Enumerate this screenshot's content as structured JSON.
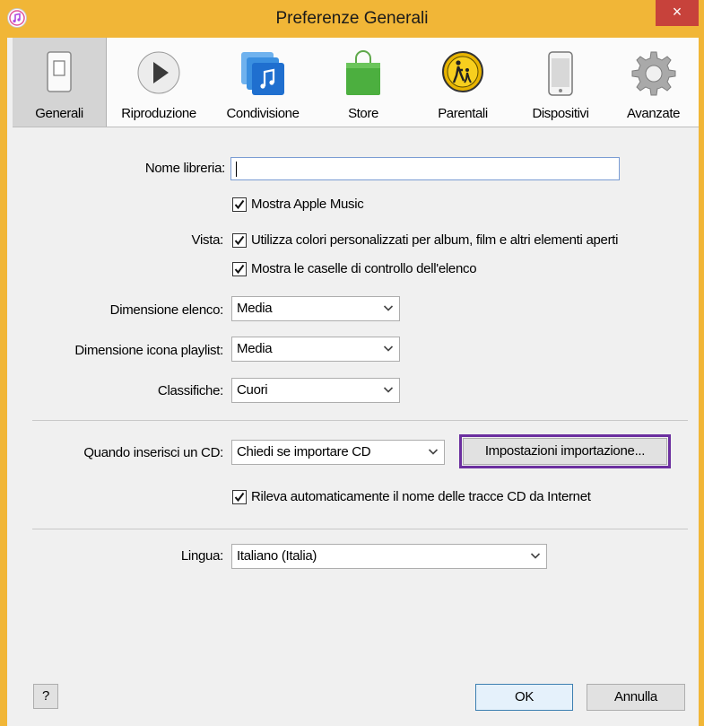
{
  "window": {
    "title": "Preferenze Generali",
    "close_label": "×",
    "accent_color": "#f1b637"
  },
  "toolbar": {
    "tabs": [
      {
        "label": "Generali",
        "icon": "general-switch-icon",
        "active": true
      },
      {
        "label": "Riproduzione",
        "icon": "play-icon"
      },
      {
        "label": "Condivisione",
        "icon": "sharing-music-icon"
      },
      {
        "label": "Store",
        "icon": "shopping-bag-icon"
      },
      {
        "label": "Parentali",
        "icon": "parental-icon"
      },
      {
        "label": "Dispositivi",
        "icon": "phone-icon"
      },
      {
        "label": "Avanzate",
        "icon": "gear-icon"
      }
    ]
  },
  "general": {
    "library_name_label": "Nome libreria:",
    "library_name_value": "",
    "view_label": "Vista:",
    "show_apple_music": "Mostra Apple Music",
    "custom_colors": "Utilizza colori personalizzati per album, film e altri elementi aperti",
    "show_checkboxes": "Mostra le caselle di controllo dell'elenco",
    "list_size_label": "Dimensione elenco:",
    "list_size_value": "Media",
    "playlist_icon_label": "Dimensione icona playlist:",
    "playlist_icon_value": "Media",
    "ratings_label": "Classifiche:",
    "ratings_value": "Cuori"
  },
  "cd": {
    "insert_label": "Quando inserisci un CD:",
    "insert_value": "Chiedi se importare CD",
    "import_settings_button": "Impostazioni importazione...",
    "auto_names": "Rileva automaticamente il nome delle tracce CD da Internet"
  },
  "language": {
    "label": "Lingua:",
    "value": "Italiano (Italia)"
  },
  "footer": {
    "help_label": "?",
    "ok_label": "OK",
    "cancel_label": "Annulla"
  }
}
